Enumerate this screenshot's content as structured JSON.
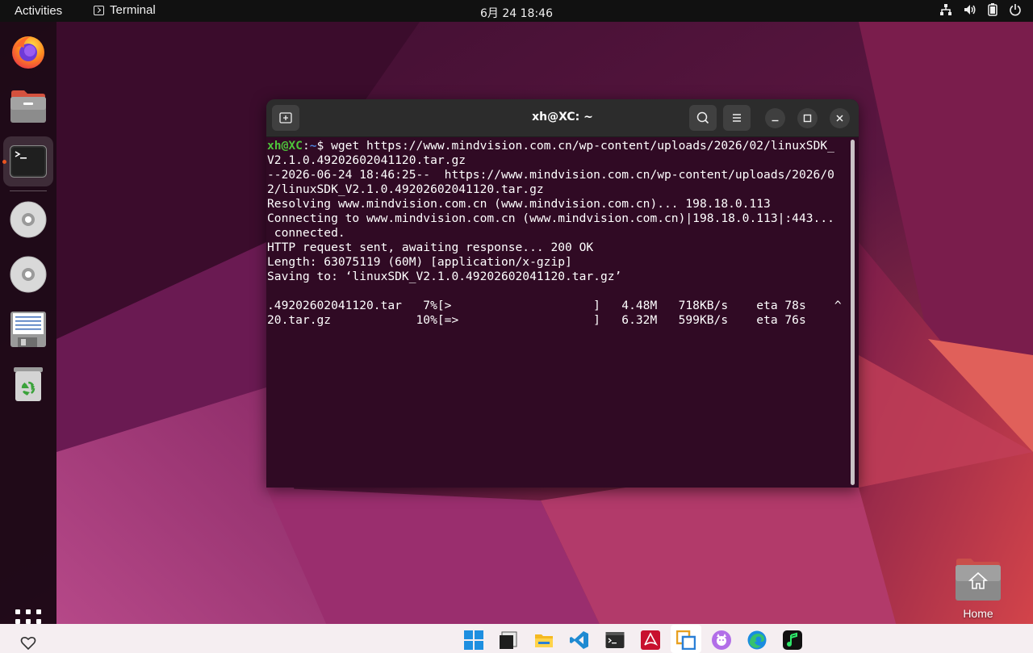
{
  "topbar": {
    "activities": "Activities",
    "app_name": "Terminal",
    "clock": "6月 24  18:46",
    "tray_icons": [
      "network-icon",
      "volume-icon",
      "battery-icon",
      "power-icon"
    ]
  },
  "dock": {
    "items": [
      {
        "name": "firefox",
        "icon": "firefox-icon"
      },
      {
        "name": "files",
        "icon": "folder-icon"
      },
      {
        "name": "terminal",
        "icon": "terminal-icon",
        "active": true
      },
      {
        "name": "disc-1",
        "icon": "disc-icon"
      },
      {
        "name": "disc-2",
        "icon": "disc-icon"
      },
      {
        "name": "floppy",
        "icon": "floppy-icon"
      },
      {
        "name": "trash",
        "icon": "trash-icon"
      }
    ],
    "show_apps_icon": "grid-icon"
  },
  "terminal": {
    "title": "xh@XC: ~",
    "prompt_user": "xh@XC",
    "prompt_sep": ":",
    "prompt_path": "~",
    "prompt_dollar": "$ ",
    "command_line_1": "wget https://www.mindvision.com.cn/wp-content/uploads/2026/02/linuxSDK_",
    "lines": [
      "V2.1.0.49202602041120.tar.gz",
      "--2026-06-24 18:46:25--  https://www.mindvision.com.cn/wp-content/uploads/2026/0",
      "2/linuxSDK_V2.1.0.49202602041120.tar.gz",
      "Resolving www.mindvision.com.cn (www.mindvision.com.cn)... 198.18.0.113",
      "Connecting to www.mindvision.com.cn (www.mindvision.com.cn)|198.18.0.113|:443...",
      " connected.",
      "HTTP request sent, awaiting response... 200 OK",
      "Length: 63075119 (60M) [application/x-gzip]",
      "Saving to: ‘linuxSDK_V2.1.0.49202602041120.tar.gz’",
      "",
      ".49202602041120.tar   7%[>                    ]   4.48M   718KB/s    eta 78s    ^",
      "20.tar.gz            10%[=>                   ]   6.32M   599KB/s    eta 76s"
    ],
    "colors": {
      "background": "#300a24",
      "user": "#4ec43b",
      "path": "#4b7fd8"
    }
  },
  "desktop": {
    "home_label": "Home"
  },
  "taskbar": {
    "items": [
      "windows-start-icon",
      "window-icon",
      "file-explorer-icon",
      "vscode-icon",
      "terminal-icon",
      "pdf-reader-icon",
      "remote-desktop-icon",
      "cat-app-icon",
      "edge-icon",
      "music-app-icon"
    ],
    "left_icon": "heart-icon"
  }
}
